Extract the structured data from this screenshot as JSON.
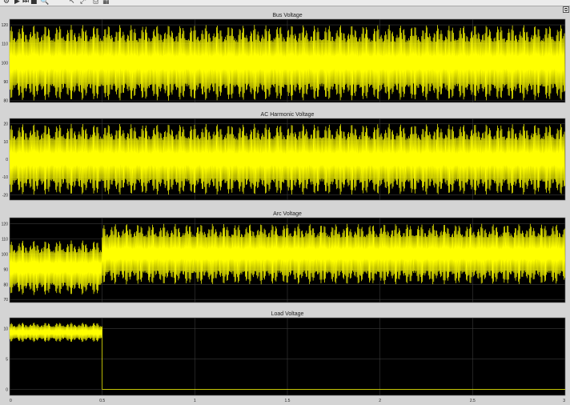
{
  "window": {
    "toolbar_icons": [
      "settings-icon",
      "run-icon",
      "step-icon",
      "stop-icon",
      "zoom-icon",
      "cursor-icon",
      "autoscale-icon",
      "print-icon",
      "measure-icon"
    ],
    "toolbar_glyphs": [
      "⚙",
      "▶",
      "⏭",
      "■",
      "🔍",
      "↖",
      "⤢",
      "⎙",
      "▦"
    ],
    "dock_label": "⧉"
  },
  "colors": {
    "background": "#000000",
    "signal": "#ffff00",
    "grid": "#3a3a3a",
    "frame": "#d4d4d4",
    "text": "#222222"
  },
  "chart_data": [
    {
      "type": "line",
      "title": "Bus Voltage",
      "xlim": [
        0,
        3
      ],
      "ylim": [
        79,
        123
      ],
      "yticks": [
        80,
        90,
        100,
        110,
        120
      ],
      "xticks": [],
      "grid": true,
      "series": [
        {
          "signal": "oscillation",
          "segments": [
            {
              "x": [
                0,
                3
              ],
              "center": 100,
              "amplitude": 20
            }
          ]
        }
      ]
    },
    {
      "type": "line",
      "title": "AC Harmonic Voltage",
      "xlim": [
        0,
        3
      ],
      "ylim": [
        -23,
        23
      ],
      "yticks": [
        -20,
        -10,
        0,
        10,
        20
      ],
      "xticks": [],
      "grid": true,
      "series": [
        {
          "signal": "oscillation",
          "segments": [
            {
              "x": [
                0,
                3
              ],
              "center": 0,
              "amplitude": 20
            }
          ]
        }
      ]
    },
    {
      "type": "line",
      "title": "Arc Voltage",
      "xlim": [
        0,
        3
      ],
      "ylim": [
        68,
        124
      ],
      "yticks": [
        70,
        80,
        90,
        100,
        110,
        120
      ],
      "xticks": [],
      "grid": true,
      "series": [
        {
          "signal": "oscillation",
          "segments": [
            {
              "x": [
                0,
                0.5
              ],
              "center": 91,
              "amplitude": 18
            },
            {
              "x": [
                0.5,
                3
              ],
              "center": 100,
              "amplitude": 20
            }
          ]
        }
      ]
    },
    {
      "type": "line",
      "title": "Load Voltage",
      "xlim": [
        0,
        3
      ],
      "ylim": [
        -1,
        11.8
      ],
      "yticks": [
        0,
        5,
        10
      ],
      "xticks": [
        0,
        0.5,
        1,
        1.5,
        2,
        2.5,
        3
      ],
      "grid": true,
      "series": [
        {
          "signal": "oscillation",
          "segments": [
            {
              "x": [
                0,
                0.5
              ],
              "center": 9.4,
              "amplitude": 1.6
            },
            {
              "x": [
                0.5,
                3
              ],
              "center": 0,
              "amplitude": 0
            }
          ]
        }
      ]
    }
  ]
}
